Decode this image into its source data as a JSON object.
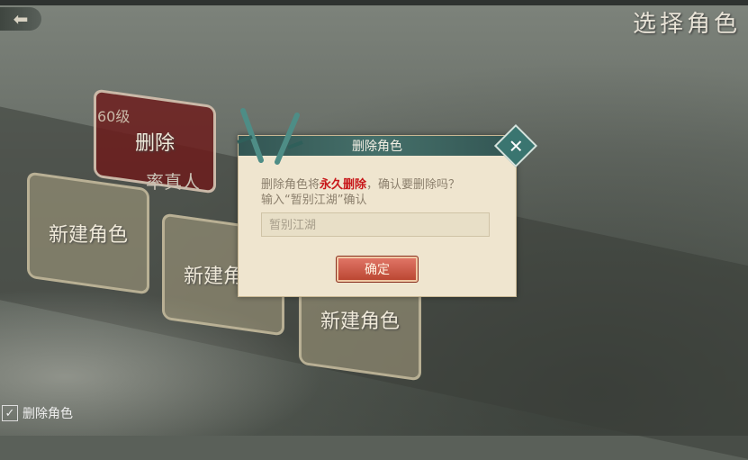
{
  "header": {
    "title": "选择角色",
    "back_icon": "arrow-left-icon"
  },
  "slots": [
    {
      "type": "character",
      "level": "60级",
      "overlay": "删除",
      "name": "率真人"
    },
    {
      "type": "empty",
      "label": "新建角色"
    },
    {
      "type": "empty",
      "label": "新建角色"
    },
    {
      "type": "empty",
      "label": "新建角色"
    }
  ],
  "delete_toggle": {
    "label": "删除角色",
    "checked": true
  },
  "dialog": {
    "title": "删除角色",
    "msg_pre": "删除角色将",
    "msg_warn": "永久删除",
    "msg_post": "，确认要删除吗？",
    "msg_line2": "输入“暂别江湖”确认",
    "input_placeholder": "暂别江湖",
    "confirm_label": "确定",
    "close_icon": "close-icon"
  },
  "colors": {
    "warn": "#c8181b",
    "dialog_bg": "#efe5cf",
    "button": "#c9523d"
  }
}
